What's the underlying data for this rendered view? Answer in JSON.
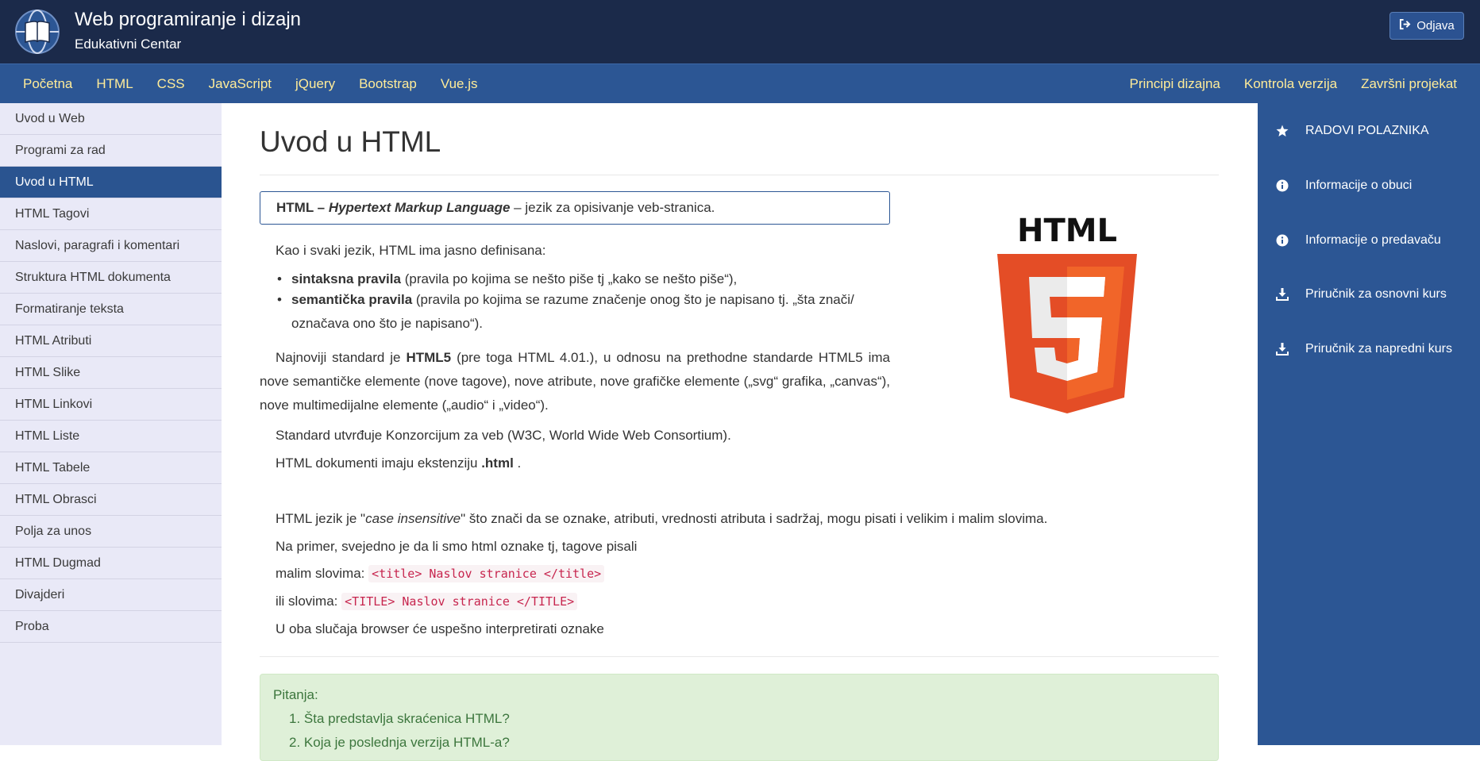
{
  "header": {
    "title": "Web programiranje i dizajn",
    "subtitle": "Edukativni Centar",
    "logout_label": "Odjava",
    "logout_icon": "sign-out-icon",
    "logo_icon": "globe-book-icon"
  },
  "nav": {
    "left": [
      "Početna",
      "HTML",
      "CSS",
      "JavaScript",
      "jQuery",
      "Bootstrap",
      "Vue.js"
    ],
    "right": [
      "Principi dizajna",
      "Kontrola verzija",
      "Završni projekat"
    ]
  },
  "sidebar": {
    "active_index": 2,
    "items": [
      "Uvod u Web",
      "Programi za rad",
      "Uvod u HTML",
      "HTML Tagovi",
      "Naslovi, paragrafi i komentari",
      "Struktura HTML dokumenta",
      "Formatiranje teksta",
      "HTML Atributi",
      "HTML Slike",
      "HTML Linkovi",
      "HTML Liste",
      "HTML Tabele",
      "HTML Obrasci",
      "Polja za unos",
      "HTML Dugmad",
      "Divajderi",
      "Proba"
    ]
  },
  "rightbar": {
    "items": [
      {
        "label": "RADOVI POLAZNIKA",
        "icon": "star-icon"
      },
      {
        "label": "Informacije o obuci",
        "icon": "info-icon"
      },
      {
        "label": "Informacije o predavaču",
        "icon": "info-icon"
      },
      {
        "label": "Priručnik za osnovni kurs",
        "icon": "download-icon"
      },
      {
        "label": "Priručnik za napredni kurs",
        "icon": "download-icon"
      }
    ]
  },
  "main": {
    "title": "Uvod u HTML",
    "def_abbr": "HTML –",
    "def_term": "Hypertext Markup Language",
    "def_rest": "– jezik za opisivanje veb-stranica.",
    "intro": "Kao i svaki jezik, HTML ima jasno definisana:",
    "b1_bold": "sintaksna pravila",
    "b1_rest": "(pravila po kojima se nešto piše tj „kako se nešto piše“),",
    "b2_bold": "semantička pravila",
    "b2_rest": "(pravila po kojima se razume značenje onog što je napisano tj. „šta znači/ označava ono što je napisano“).",
    "p1_a": "Najnoviji standard je",
    "p1_bold": "HTML5",
    "p1_b": "(pre toga HTML 4.01.), u odnosu na prethodne standarde HTML5 ima nove semantičke elemente (nove tagove), nove atribute, nove grafičke elemente („svg“ grafika, „canvas“), nove multimedijalne elemente („audio“ i „video“).",
    "p2": "Standard utvrđuje Konzorcijum za veb (W3C, World Wide Web Consortium).",
    "p3_a": "HTML dokumenti imaju ekstenziju",
    "p3_bold": ".html",
    "p3_b": ".",
    "p4_a": "HTML jezik je \"",
    "p4_italic": "case insensitive",
    "p4_b": "\" što znači da se oznake, atributi, vrednosti atributa i sadržaj, mogu pisati i velikim i malim slovima.",
    "p5": "Na primer, svejedno je da li smo html oznake tj, tagove pisali",
    "p6_label": "malim slovima:",
    "p6_code": "<title> Naslov stranice </title>",
    "p7_label": "ili slovima:",
    "p7_code": "<TITLE> Naslov stranice </TITLE>",
    "p8": "U oba slučaja browser će uspešno interpretirati oznake",
    "image_wordmark": "HTML",
    "image_icon": "html5-logo-icon"
  },
  "questions": {
    "title": "Pitanja:",
    "items": [
      "Šta predstavlja skraćenica HTML?",
      "Koja je poslednja verzija HTML-a?"
    ]
  },
  "colors": {
    "topbar": "#1b2a4a",
    "navbar": "#2c5694",
    "nav_text": "#ffec99",
    "sidebar_bg": "#e9e9f7",
    "active": "#2a5490",
    "html5_orange": "#e44d26",
    "html5_light": "#f16529",
    "question_bg": "#dff0d8",
    "question_text": "#3c763d"
  }
}
